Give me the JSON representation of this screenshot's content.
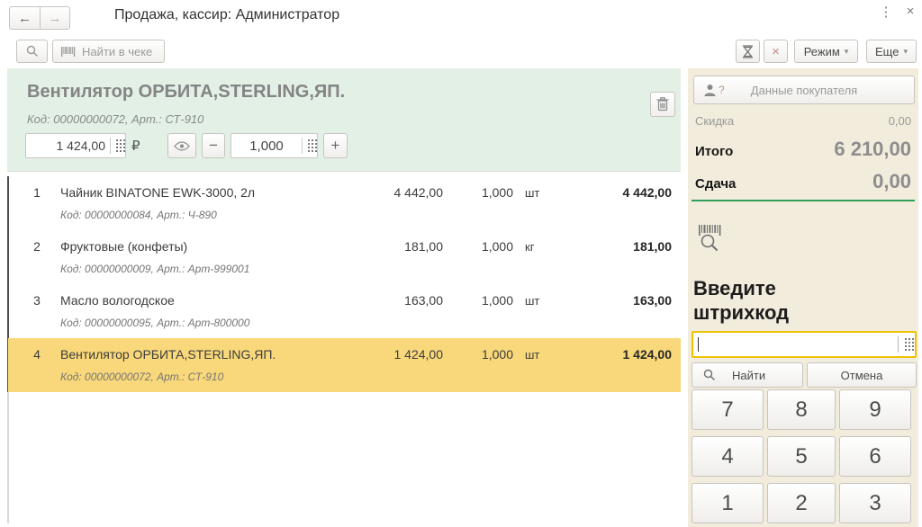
{
  "window": {
    "title": "Продажа, кассир: Администратор",
    "back_icon": "←",
    "forward_icon": "→",
    "kebab_icon": "⋮",
    "close_icon": "×"
  },
  "toolbar": {
    "find_in_receipt_label": "Найти в чеке",
    "cancel_x_icon": "×",
    "mode_label": "Режим",
    "more_label": "Еще",
    "dropdown_icon": "▾"
  },
  "product_panel": {
    "name": "Вентилятор ОРБИТА,STERLING,ЯП.",
    "code": "Код: 00000000072, Арт.: СТ-910",
    "price": "1 424,00",
    "currency": "₽",
    "minus_label": "−",
    "quantity": "1,000",
    "plus_label": "+"
  },
  "receipt": {
    "items": [
      {
        "num": "1",
        "name": "Чайник BINATONE EWK-3000, 2л",
        "code": "Код: 00000000084, Арт.: Ч-890",
        "price": "4 442,00",
        "qty": "1,000",
        "unit": "шт",
        "total": "4 442,00"
      },
      {
        "num": "2",
        "name": "Фруктовые (конфеты)",
        "code": "Код: 00000000009, Арт.: Арт-999001",
        "price": "181,00",
        "qty": "1,000",
        "unit": "кг",
        "total": "181,00"
      },
      {
        "num": "3",
        "name": "Масло вологодское",
        "code": "Код: 00000000095, Арт.: Арт-800000",
        "price": "163,00",
        "qty": "1,000",
        "unit": "шт",
        "total": "163,00"
      },
      {
        "num": "4",
        "name": "Вентилятор ОРБИТА,STERLING,ЯП.",
        "code": "Код: 00000000072, Арт.: СТ-910",
        "price": "1 424,00",
        "qty": "1,000",
        "unit": "шт",
        "total": "1 424,00",
        "selected": true
      }
    ]
  },
  "summary": {
    "customer_button_label": "Данные покупателя",
    "customer_help_mark": "?",
    "discount_label": "Скидка",
    "discount_value": "0,00",
    "total_label": "Итого",
    "total_value": "6 210,00",
    "change_label": "Сдача",
    "change_value": "0,00"
  },
  "barcode_panel": {
    "prompt": "Введите штрихкод",
    "input_value": "",
    "find_label": "Найти",
    "cancel_label": "Отмена",
    "numpad": [
      "7",
      "8",
      "9",
      "4",
      "5",
      "6",
      "1",
      "2",
      "3"
    ]
  },
  "colors": {
    "header_green": "#e2f0e5",
    "selected_row_yellow": "#f8d87a",
    "side_panel_beige": "#f1ecdc",
    "divider_green": "#2f9e57",
    "barcode_input_border": "#eec200"
  }
}
